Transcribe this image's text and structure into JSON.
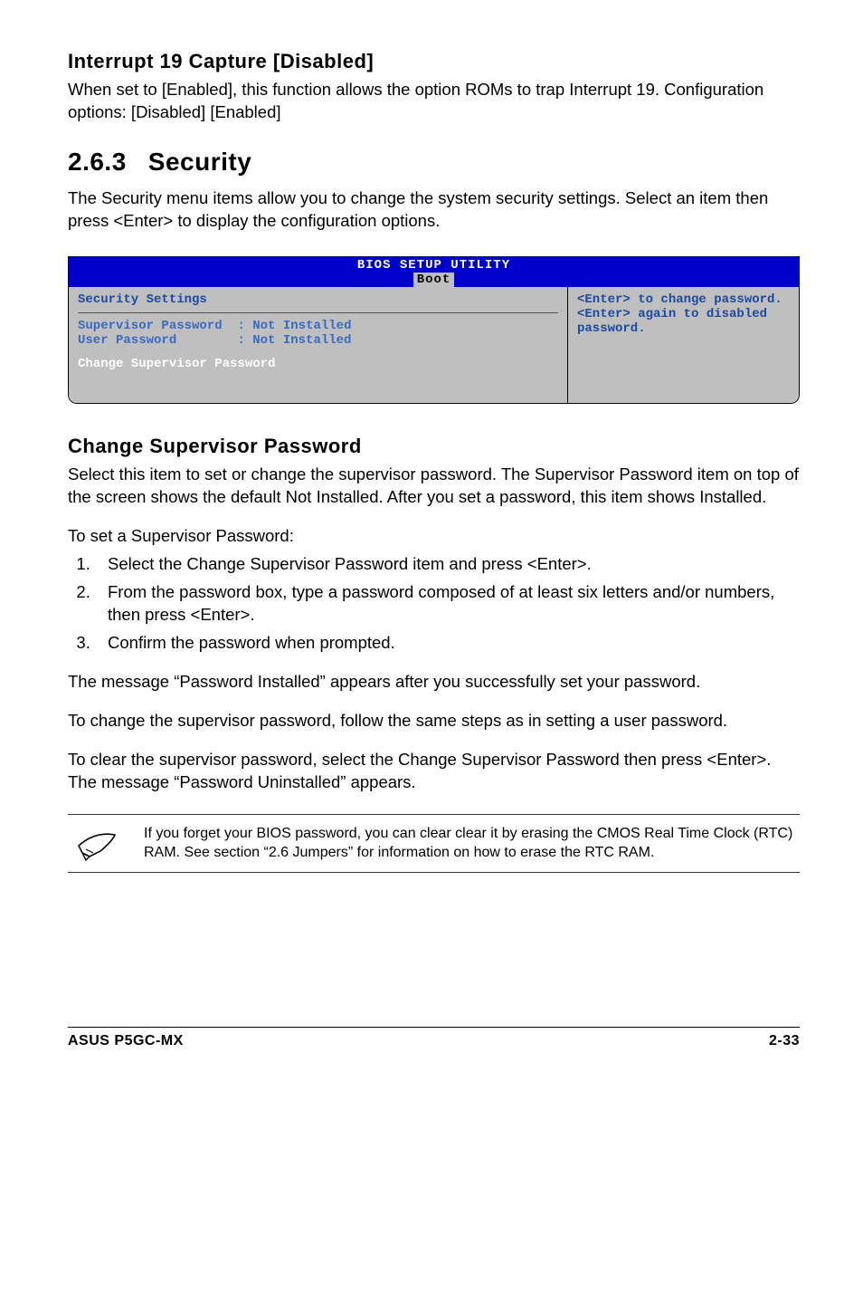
{
  "section1": {
    "heading": "Interrupt 19 Capture [Disabled]",
    "body": "When set to [Enabled], this function allows the option ROMs to trap Interrupt 19. Configuration options: [Disabled] [Enabled]"
  },
  "section2": {
    "num": "2.6.3",
    "title": "Security",
    "body": "The Security menu items allow you to change the system security settings. Select an item then press <Enter> to display the configuration options."
  },
  "bios": {
    "header_title": "BIOS SETUP UTILITY",
    "header_tab": "Boot",
    "left_title": "Security Settings",
    "row1_label": "Supervisor Password",
    "row1_value": ": Not Installed",
    "row2_label": "User Password",
    "row2_value": ": Not Installed",
    "left_action": "Change Supervisor Password",
    "help1": "<Enter> to change password.",
    "help2": "<Enter> again to disabled password."
  },
  "section3": {
    "heading": "Change Supervisor Password",
    "p1": "Select this item to set or change the supervisor password. The Supervisor Password item on top of the screen shows the default Not Installed. After you set a password, this item shows Installed.",
    "p2": "To set a Supervisor Password:",
    "steps": [
      "Select the Change Supervisor Password item and press <Enter>.",
      "From the password box, type a password composed of at least six letters and/or numbers, then press <Enter>.",
      "Confirm the password when prompted."
    ],
    "p3": "The message “Password Installed” appears after you successfully set your password.",
    "p4": "To change the supervisor password, follow the same steps as in setting a user password.",
    "p5": "To clear the supervisor password, select the Change Supervisor Password then press <Enter>. The message “Password Uninstalled” appears."
  },
  "note": "If you forget your BIOS password, you can clear clear it by erasing the CMOS Real Time Clock (RTC) RAM. See section “2.6  Jumpers” for information on how to erase the RTC RAM.",
  "footer": {
    "left": "ASUS P5GC-MX",
    "right": "2-33"
  }
}
